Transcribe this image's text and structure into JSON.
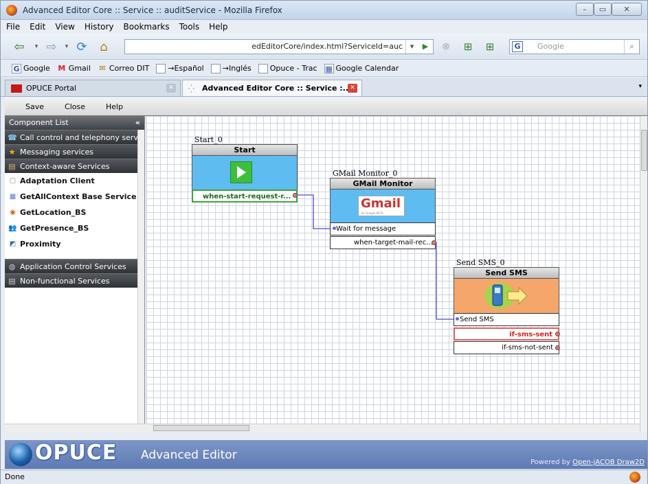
{
  "window": {
    "title": "Advanced Editor Core :: Service :: auditService - Mozilla Firefox",
    "minimize": "–",
    "maximize": "▭",
    "close": "✕"
  },
  "menubar": [
    "File",
    "Edit",
    "View",
    "History",
    "Bookmarks",
    "Tools",
    "Help"
  ],
  "navbar": {
    "url": "edEditorCore/index.html?ServiceId=auc",
    "search_placeholder": "Google",
    "search_engine": "G"
  },
  "bookmarks": [
    {
      "label": "Google",
      "icon": "G"
    },
    {
      "label": "Gmail",
      "icon": "M"
    },
    {
      "label": "Correo DIT",
      "icon": "✉"
    },
    {
      "label": "→Español",
      "icon": ""
    },
    {
      "label": "→Inglés",
      "icon": ""
    },
    {
      "label": "Opuce - Trac",
      "icon": ""
    },
    {
      "label": "Google Calendar",
      "icon": "▦"
    }
  ],
  "tabs": [
    {
      "label": "OPUCE Portal"
    },
    {
      "label": "Advanced Editor Core :: Service :..."
    }
  ],
  "toolbar": {
    "save": "Save",
    "close": "Close",
    "help": "Help"
  },
  "component_list": {
    "header": "Component List",
    "collapse": "«",
    "categories_top": [
      {
        "label": "Call control and telephony services",
        "icon": "☎"
      },
      {
        "label": "Messaging services",
        "icon": "★"
      },
      {
        "label": "Context-aware Services",
        "icon": "▤"
      }
    ],
    "items": [
      {
        "label": "Adaptation Client",
        "icon": "▢"
      },
      {
        "label": "GetAllContext Base Service",
        "icon": "▦"
      },
      {
        "label": "GetLocation_BS",
        "icon": "◉"
      },
      {
        "label": "GetPresence_BS",
        "icon": "👥"
      },
      {
        "label": "Proximity",
        "icon": "◩"
      }
    ],
    "categories_bottom": [
      {
        "label": "Application Control Services",
        "icon": "◍"
      },
      {
        "label": "Non-functional Services",
        "icon": "▤"
      }
    ]
  },
  "nodes": {
    "start": {
      "name": "Start_0",
      "title": "Start",
      "port": "when-start-request-r..."
    },
    "gmail": {
      "name": "GMail Monitor_0",
      "title": "GMail Monitor",
      "logo": "Gmail",
      "logo_sub": "by Google   BETA",
      "input": "Wait for message",
      "output": "when-target-mail-rec..."
    },
    "sms": {
      "name": "Send SMS_0",
      "title": "Send SMS",
      "input": "Send SMS",
      "out1": "if-sms-sent",
      "out2": "if-sms-not-sent"
    }
  },
  "footer": {
    "logo": "OPUCE",
    "subtitle": "Advanced Editor",
    "powered_by": "Powered by",
    "powered_link": "Open-jACOB Draw2D"
  },
  "status": "Done",
  "colors": {
    "accent": "#5e7ab3",
    "node_body": "#5ebcf0",
    "sms_body": "#f5a76b",
    "sent_red": "#e02020",
    "wire": "#4a4ad0"
  }
}
